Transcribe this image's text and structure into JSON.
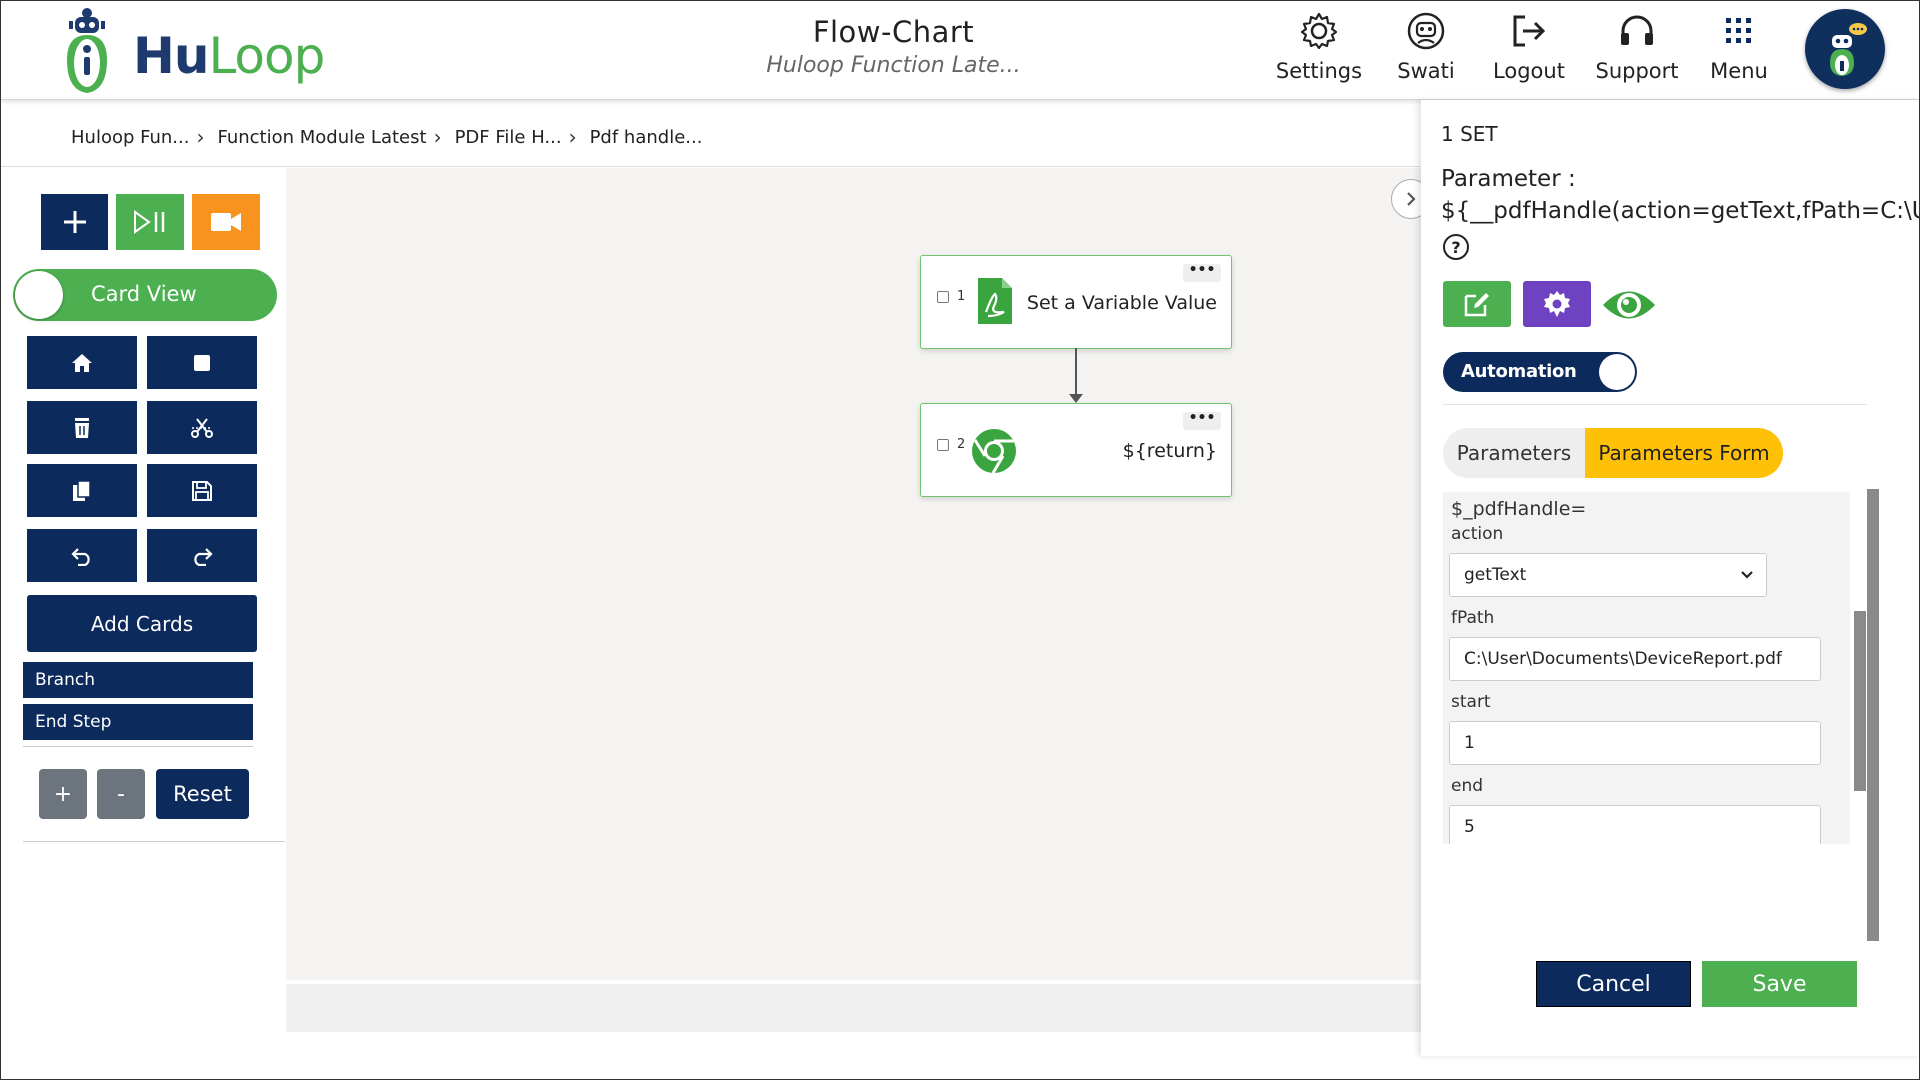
{
  "header": {
    "logo_text_a": "Hu",
    "logo_text_b": "Loop",
    "title": "Flow-Chart",
    "subtitle": "Huloop Function Late...",
    "nav": [
      {
        "label": "Settings",
        "icon": "gear-icon"
      },
      {
        "label": "Swati",
        "icon": "robot-icon"
      },
      {
        "label": "Logout",
        "icon": "logout-icon"
      },
      {
        "label": "Support",
        "icon": "headset-icon"
      },
      {
        "label": "Menu",
        "icon": "grid-icon"
      }
    ]
  },
  "breadcrumb": [
    "Huloop Fun...",
    "Function Module Latest",
    "PDF File H...",
    "Pdf handle..."
  ],
  "left_panel": {
    "card_view_label": "Card View",
    "add_cards_label": "Add Cards",
    "branch_label": "Branch",
    "end_step_label": "End Step",
    "zoom_in_label": "+",
    "zoom_out_label": "-",
    "reset_label": "Reset"
  },
  "canvas": {
    "cards": [
      {
        "number": "1",
        "text": "Set a Variable Value",
        "icon": "pdf-icon",
        "menu": "•••"
      },
      {
        "number": "2",
        "text": "${return}",
        "icon": "chrome-icon",
        "menu": "•••"
      }
    ]
  },
  "right_panel": {
    "set_label": "1 SET",
    "parameter_label": "Parameter :",
    "parameter_value": "${__pdfHandle(action=getText,fPath=C:\\Us",
    "help_label": "?",
    "automation_label": "Automation",
    "tabs": [
      {
        "label": "Parameters",
        "active": false
      },
      {
        "label": "Parameters Form",
        "active": true
      }
    ],
    "form": {
      "heading": "$_pdfHandle=",
      "action_label": "action",
      "action_value": "getText",
      "fpath_label": "fPath",
      "fpath_value": "C:\\User\\Documents\\DeviceReport.pdf",
      "start_label": "start",
      "start_value": "1",
      "end_label": "end",
      "end_value": "5"
    },
    "cancel_label": "Cancel",
    "save_label": "Save"
  },
  "colors": {
    "navy": "#0d2a5c",
    "green": "#4cb050",
    "orange": "#f7931e",
    "purple": "#6f42c1",
    "tab_active": "#ffc107"
  }
}
